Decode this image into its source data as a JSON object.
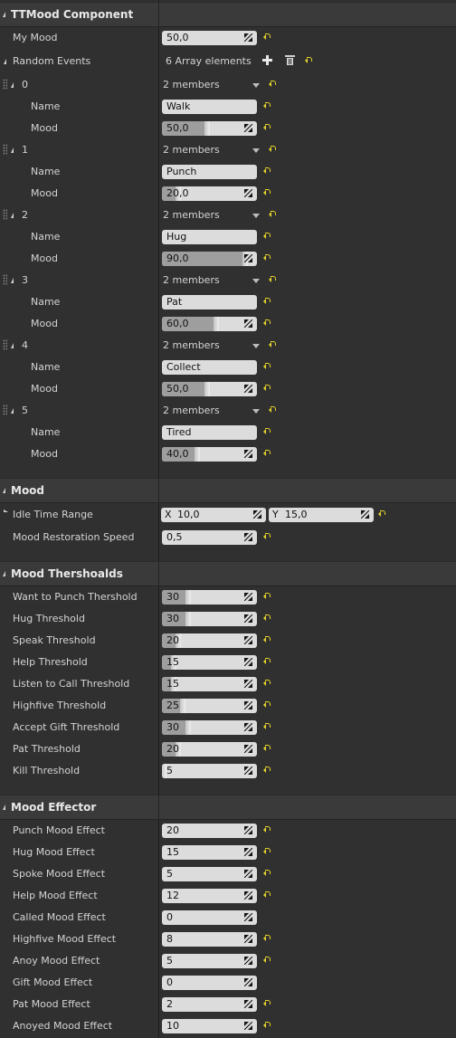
{
  "component": {
    "title": "TTMood Component",
    "my_mood": {
      "label": "My Mood",
      "value": "50,0",
      "level": 0.5
    },
    "random_events": {
      "label": "Random Events",
      "summary": "6 Array elements",
      "items": [
        {
          "index": "0",
          "members": "2 members",
          "name_label": "Name",
          "name": "Walk",
          "mood_label": "Mood",
          "mood": "50,0",
          "level": 0.5
        },
        {
          "index": "1",
          "members": "2 members",
          "name_label": "Name",
          "name": "Punch",
          "mood_label": "Mood",
          "mood": "20,0",
          "level": 0.2
        },
        {
          "index": "2",
          "members": "2 members",
          "name_label": "Name",
          "name": "Hug",
          "mood_label": "Mood",
          "mood": "90,0",
          "level": 0.9
        },
        {
          "index": "3",
          "members": "2 members",
          "name_label": "Name",
          "name": "Pat",
          "mood_label": "Mood",
          "mood": "60,0",
          "level": 0.6
        },
        {
          "index": "4",
          "members": "2 members",
          "name_label": "Name",
          "name": "Collect",
          "mood_label": "Mood",
          "mood": "50,0",
          "level": 0.5
        },
        {
          "index": "5",
          "members": "2 members",
          "name_label": "Name",
          "name": "Tired",
          "mood_label": "Mood",
          "mood": "40,0",
          "level": 0.4
        }
      ]
    }
  },
  "mood": {
    "title": "Mood",
    "idle_time_range": {
      "label": "Idle Time Range",
      "x_label": "X",
      "x": "10,0",
      "y_label": "Y",
      "y": "15,0"
    },
    "restoration": {
      "label": "Mood Restoration Speed",
      "value": "0,5"
    }
  },
  "thresholds": {
    "title": "Mood Thershoalds",
    "rows": [
      {
        "label": "Want to Punch Thershold",
        "value": "30",
        "level": 0.3,
        "reset": true
      },
      {
        "label": "Hug Threshold",
        "value": "30",
        "level": 0.3,
        "reset": true
      },
      {
        "label": "Speak Threshold",
        "value": "20",
        "level": 0.2,
        "reset": true
      },
      {
        "label": "Help Threshold",
        "value": "15",
        "level": 0.15,
        "reset": true
      },
      {
        "label": "Listen to Call Threshold",
        "value": "15",
        "level": 0.15,
        "reset": true
      },
      {
        "label": "Highfive Threshold",
        "value": "25",
        "level": 0.25,
        "reset": true
      },
      {
        "label": "Accept Gift Threshold",
        "value": "30",
        "level": 0.3,
        "reset": true
      },
      {
        "label": "Pat Threshold",
        "value": "20",
        "level": 0.2,
        "reset": true
      },
      {
        "label": "Kill Threshold",
        "value": "5",
        "level": 0.05,
        "reset": true
      }
    ]
  },
  "effector": {
    "title": "Mood Effector",
    "rows": [
      {
        "label": "Punch Mood Effect",
        "value": "20",
        "reset": true
      },
      {
        "label": "Hug Mood Effect",
        "value": "15",
        "reset": true
      },
      {
        "label": "Spoke Mood Effect",
        "value": "5",
        "reset": true
      },
      {
        "label": "Help Mood Effect",
        "value": "12",
        "reset": true
      },
      {
        "label": "Called Mood Effect",
        "value": "0",
        "reset": false
      },
      {
        "label": "Highfive Mood Effect",
        "value": "8",
        "reset": true
      },
      {
        "label": "Anoy Mood Effect",
        "value": "5",
        "reset": true
      },
      {
        "label": "Gift Mood Effect",
        "value": "0",
        "reset": false
      },
      {
        "label": "Pat Mood Effect",
        "value": "2",
        "reset": true
      },
      {
        "label": "Anoyed Mood Effect",
        "value": "10",
        "reset": true
      }
    ]
  },
  "colors": {
    "panel": "#303030",
    "header": "#3a3a3a",
    "field": "#dcdcdc",
    "reset_arrow": "#e5d22a"
  }
}
